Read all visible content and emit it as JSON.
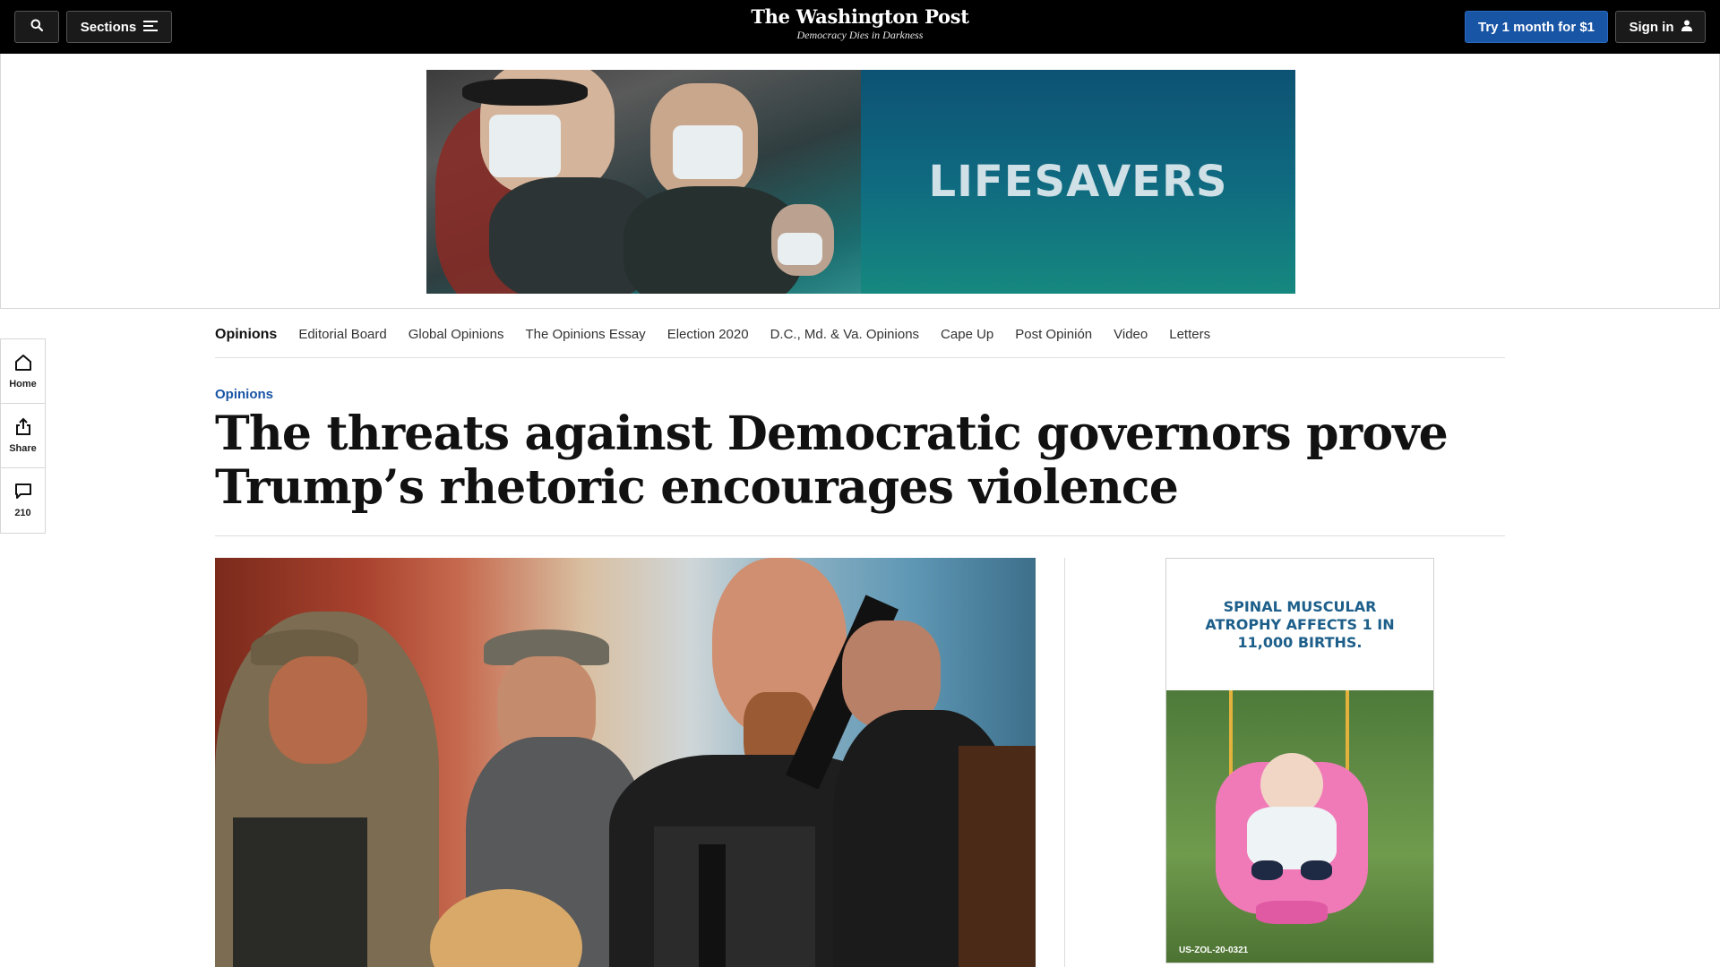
{
  "header": {
    "sections_label": "Sections",
    "logo_text": "The Washington Post",
    "tagline": "Democracy Dies in Darkness",
    "subscribe_label": "Try 1 month for $1",
    "signin_label": "Sign in"
  },
  "top_ad": {
    "brand_text": "LIFESAVERS"
  },
  "rail": {
    "home_label": "Home",
    "share_label": "Share",
    "comments_count": "210"
  },
  "section_nav": {
    "home": "Opinions",
    "items": [
      "Editorial Board",
      "Global Opinions",
      "The Opinions Essay",
      "Election 2020",
      "D.C., Md. & Va. Opinions",
      "Cape Up",
      "Post Opinión",
      "Video",
      "Letters"
    ]
  },
  "article": {
    "kicker": "Opinions",
    "headline": "The threats against Democratic governors prove Trump’s rhetoric encourages violence"
  },
  "side_ad": {
    "headline": "SPINAL MUSCULAR ATROPHY AFFECTS 1 IN 11,000 BIRTHS.",
    "code": "US-ZOL-20-0321"
  },
  "colors": {
    "topbar_bg": "#000000",
    "accent_blue": "#1955a5",
    "kicker_blue": "#1955a5"
  },
  "icons": {
    "search": "search-icon",
    "sections": "menu-lines-icon",
    "signin": "user-icon",
    "home": "home-icon",
    "share": "share-icon",
    "comments": "comment-icon"
  }
}
